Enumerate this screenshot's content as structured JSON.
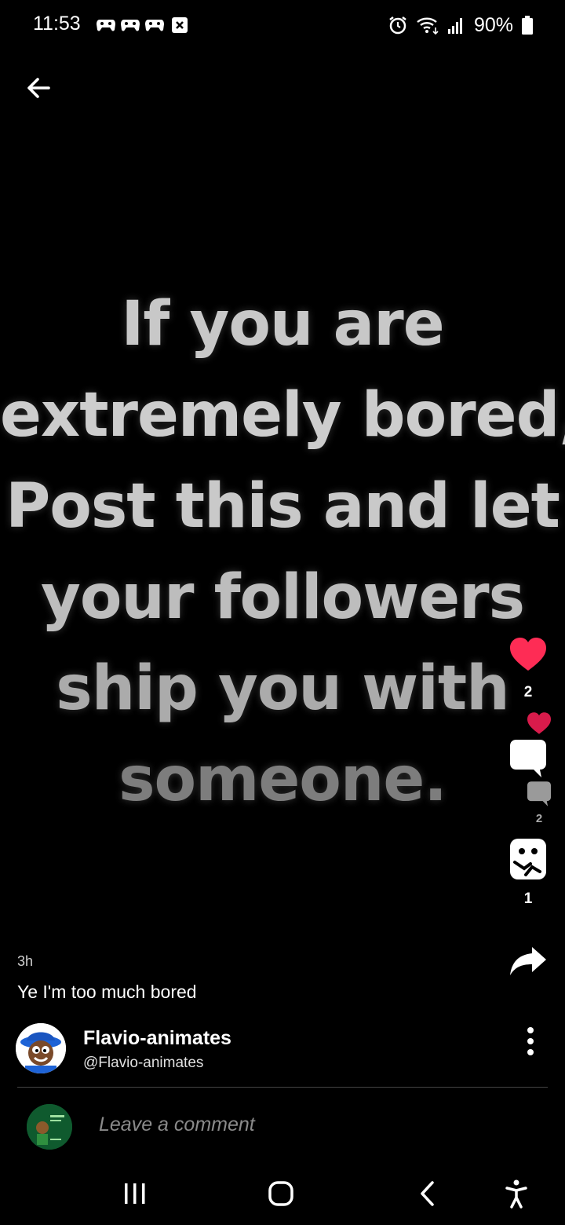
{
  "status_bar": {
    "time": "11:53",
    "notification_icons": [
      "gamepad-icon",
      "gamepad-icon",
      "gamepad-icon",
      "close-box-icon"
    ],
    "right_icons": [
      "alarm-icon",
      "wifi-icon",
      "signal-icon"
    ],
    "battery_percent": "90%"
  },
  "post": {
    "image_text_lines": [
      "If you are",
      "extremely bored,",
      "Post this and let",
      "your followers",
      "ship you with",
      "someone."
    ],
    "time_ago": "3h",
    "caption": "Ye I'm too much bored"
  },
  "actions": {
    "likes": "2",
    "comments": "2",
    "reposts": "1"
  },
  "author": {
    "name": "Flavio-animates",
    "handle": "@Flavio-animates"
  },
  "comment": {
    "placeholder": "Leave a comment"
  },
  "colors": {
    "background": "#000000",
    "like_red": "#fe2c55",
    "secondary_heart": "#d81b4b",
    "text": "#ffffff",
    "muted": "#8a8a8a"
  }
}
